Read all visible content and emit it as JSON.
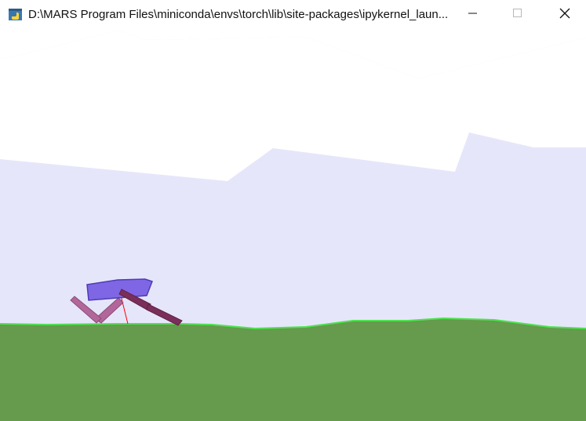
{
  "window": {
    "title": "D:\\MARS Program Files\\miniconda\\envs\\torch\\lib\\site-packages\\ipykernel_laun...",
    "controls": {
      "minimize_icon": "minimize-icon",
      "maximize_icon": "maximize-icon",
      "close_icon": "close-icon"
    }
  },
  "scene": {
    "colors": {
      "sky": "#e6e6fb",
      "cloud": "#ffffff",
      "ground": "#669a4d",
      "ground_edge": "#4ee34e",
      "hull": "#7f66e5",
      "hull_outline": "#4d3db3",
      "leg_back": "#b36699",
      "leg_front": "#7a2e59",
      "lidar": "#ff0000"
    }
  }
}
